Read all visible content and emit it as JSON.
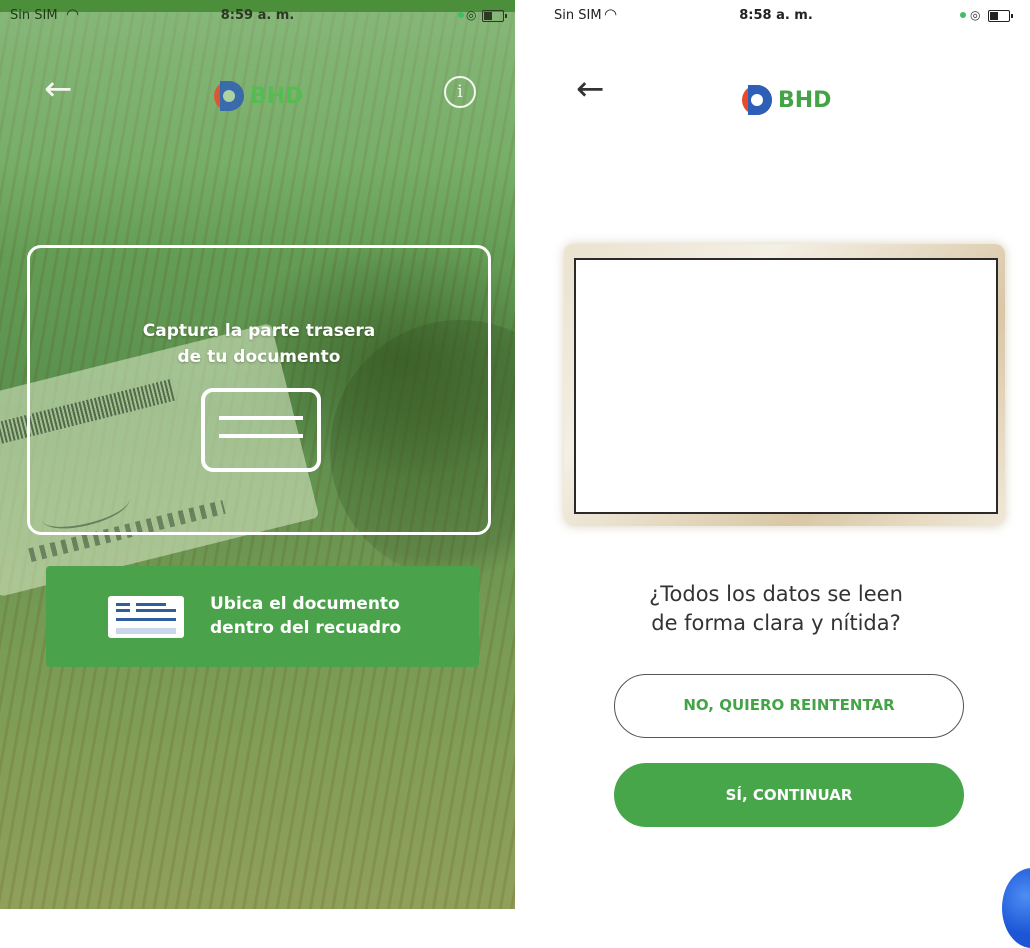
{
  "left_screen": {
    "status_bar": {
      "carrier": "Sin SIM",
      "time": "8:59 a. m."
    },
    "header": {
      "brand": "BHD"
    },
    "capture_frame": {
      "title_line1": "Captura la parte trasera",
      "title_line2": "de tu documento"
    },
    "hint": {
      "line1": "Ubica el documento",
      "line2": "dentro del recuadro"
    }
  },
  "right_screen": {
    "status_bar": {
      "carrier": "Sin SIM",
      "time": "8:58 a. m."
    },
    "header": {
      "brand": "BHD"
    },
    "question": {
      "line1": "¿Todos los datos se leen",
      "line2": "de forma clara y nítida?"
    },
    "buttons": {
      "retry": "NO, QUIERO REINTENTAR",
      "continue": "SÍ, CONTINUAR"
    }
  },
  "icons": {
    "back": "arrow-left-icon",
    "info": "info-icon",
    "wifi": "wifi-icon",
    "battery": "battery-icon",
    "document": "document-card-icon"
  },
  "colors": {
    "brand_green": "#47a649",
    "text_dark": "#333333",
    "logo_blue": "#2e5fb8",
    "logo_red": "#e84a2b"
  }
}
